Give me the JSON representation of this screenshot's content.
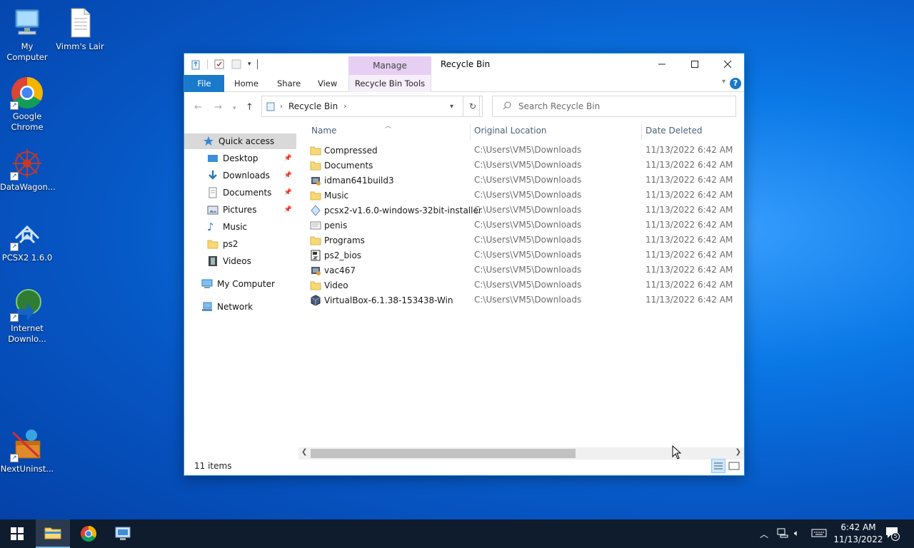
{
  "desktop": {
    "icons": [
      {
        "label": "My Computer"
      },
      {
        "label": "Vimm's Lair"
      },
      {
        "label": "Google Chrome"
      },
      {
        "label": "DataWagon..."
      },
      {
        "label": "PCSX2 1.6.0"
      },
      {
        "label": "Internet Downlo..."
      },
      {
        "label": "NextUninst..."
      }
    ]
  },
  "window": {
    "title": "Recycle Bin",
    "contextual_tab": "Manage",
    "tabs": {
      "file": "File",
      "home": "Home",
      "share": "Share",
      "view": "View",
      "tools": "Recycle Bin Tools"
    },
    "address": {
      "segment": "Recycle Bin"
    },
    "search": {
      "placeholder": "Search Recycle Bin"
    },
    "nav": {
      "quick_access": "Quick access",
      "desktop": "Desktop",
      "downloads": "Downloads",
      "documents": "Documents",
      "pictures": "Pictures",
      "music": "Music",
      "ps2": "ps2",
      "videos": "Videos",
      "my_computer": "My Computer",
      "network": "Network"
    },
    "columns": {
      "name": "Name",
      "location": "Original Location",
      "date": "Date Deleted"
    },
    "files": [
      {
        "name": "Compressed",
        "location": "C:\\Users\\VM5\\Downloads",
        "date": "11/13/2022 6:42 AM",
        "icon": "folder"
      },
      {
        "name": "Documents",
        "location": "C:\\Users\\VM5\\Downloads",
        "date": "11/13/2022 6:42 AM",
        "icon": "folder"
      },
      {
        "name": "idman641build3",
        "location": "C:\\Users\\VM5\\Downloads",
        "date": "11/13/2022 6:42 AM",
        "icon": "installer"
      },
      {
        "name": "Music",
        "location": "C:\\Users\\VM5\\Downloads",
        "date": "11/13/2022 6:42 AM",
        "icon": "folder"
      },
      {
        "name": "pcsx2-v1.6.0-windows-32bit-installer",
        "location": "C:\\Users\\VM5\\Downloads",
        "date": "11/13/2022 6:42 AM",
        "icon": "exe"
      },
      {
        "name": "penis",
        "location": "C:\\Users\\VM5\\Downloads",
        "date": "11/13/2022 6:42 AM",
        "icon": "file"
      },
      {
        "name": "Programs",
        "location": "C:\\Users\\VM5\\Downloads",
        "date": "11/13/2022 6:42 AM",
        "icon": "folder"
      },
      {
        "name": "ps2_bios",
        "location": "C:\\Users\\VM5\\Downloads",
        "date": "11/13/2022 6:42 AM",
        "icon": "zip"
      },
      {
        "name": "vac467",
        "location": "C:\\Users\\VM5\\Downloads",
        "date": "11/13/2022 6:42 AM",
        "icon": "installer"
      },
      {
        "name": "Video",
        "location": "C:\\Users\\VM5\\Downloads",
        "date": "11/13/2022 6:42 AM",
        "icon": "folder"
      },
      {
        "name": "VirtualBox-6.1.38-153438-Win",
        "location": "C:\\Users\\VM5\\Downloads",
        "date": "11/13/2022 6:42 AM",
        "icon": "virtualbox"
      }
    ],
    "status": {
      "count": "11 items"
    }
  },
  "taskbar": {
    "time": "6:42 AM",
    "date": "11/13/2022",
    "notification_count": "5"
  },
  "colors": {
    "accent": "#1979ca",
    "manage_tab": "#e6cff3",
    "taskbar": "#0f1c2e"
  }
}
